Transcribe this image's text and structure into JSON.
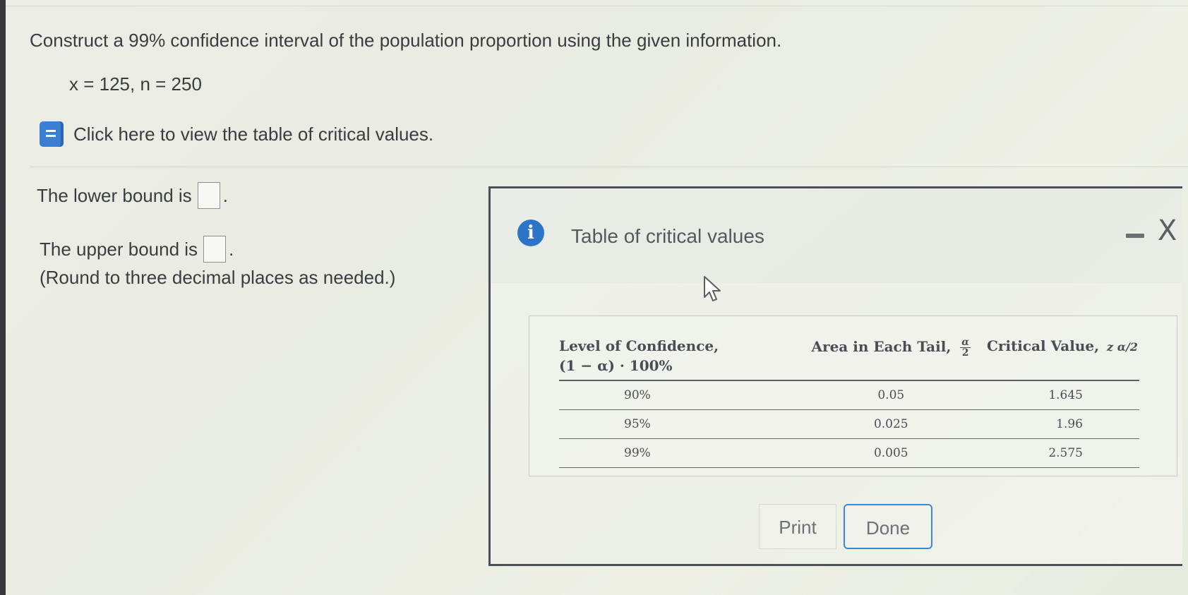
{
  "question": {
    "text": "Construct a 99% confidence interval of the population proportion using the given information.",
    "given": "x = 125, n = 250"
  },
  "link": {
    "icon": "book-icon",
    "text": "Click here to view the table of critical values."
  },
  "answers": {
    "lower_label": "The lower bound is",
    "lower_value": "",
    "upper_label": "The upper bound is",
    "upper_value": "",
    "round_note": "(Round to three decimal places as needed.)"
  },
  "modal": {
    "title": "Table of critical values",
    "info_icon": "i",
    "close_glyph": "X",
    "table": {
      "headers": {
        "col1_line1": "Level of Confidence,",
        "col1_line2": "(1 − α) · 100%",
        "col2": "Area in Each Tail,",
        "col2_frac_num": "α",
        "col2_frac_den": "2",
        "col3": "Critical Value,",
        "col3_symbol": "z α/2"
      },
      "rows": [
        {
          "confidence": "90%",
          "area": "0.05",
          "critical": "1.645"
        },
        {
          "confidence": "95%",
          "area": "0.025",
          "critical": "1.96"
        },
        {
          "confidence": "99%",
          "area": "0.005",
          "critical": "2.575"
        }
      ]
    },
    "print_label": "Print",
    "done_label": "Done"
  },
  "colors": {
    "accent": "#3f86d6",
    "info": "#2d74c8",
    "text": "#3a3d40"
  }
}
